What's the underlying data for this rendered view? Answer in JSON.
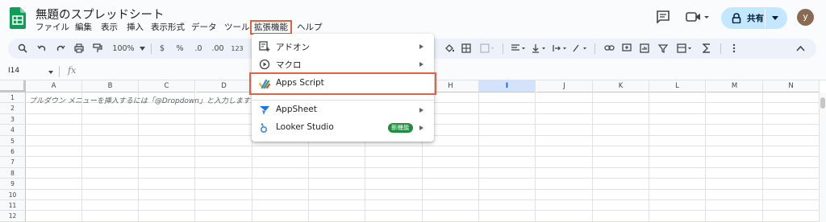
{
  "title": "無題のスプレッドシート",
  "menu": [
    {
      "label": "ファイル"
    },
    {
      "label": "編集"
    },
    {
      "label": "表示"
    },
    {
      "label": "挿入"
    },
    {
      "label": "表示形式"
    },
    {
      "label": "データ"
    },
    {
      "label": "ツール"
    },
    {
      "label": "拡張機能"
    },
    {
      "label": "ヘルプ"
    }
  ],
  "share": {
    "label": "共有"
  },
  "avatar": {
    "initial": "y"
  },
  "toolbar": {
    "zoom": "100%",
    "currency": "$",
    "percent": "%",
    "dec_less": ".0",
    "dec_more": ".00",
    "format_123": "123"
  },
  "formula_bar": {
    "cell_ref": "I14",
    "fx": "fx"
  },
  "grid": {
    "columns": [
      "A",
      "B",
      "C",
      "D",
      "E",
      "F",
      "G",
      "H",
      "I",
      "J",
      "K",
      "L",
      "M",
      "N"
    ],
    "selected_column": "I",
    "rows": [
      "1",
      "2",
      "3",
      "4",
      "5",
      "6",
      "7",
      "8",
      "9",
      "10",
      "11",
      "12"
    ],
    "a1_hint": "プルダウン メニューを挿入するには「@Dropdown」と入力します"
  },
  "dropdown": {
    "items": [
      {
        "label": "アドオン",
        "icon": "addons-icon",
        "has_submenu": true
      },
      {
        "label": "マクロ",
        "icon": "macro-play-icon",
        "has_submenu": true
      },
      {
        "label": "Apps Script",
        "icon": "apps-script-icon",
        "has_submenu": false
      },
      {
        "label": "AppSheet",
        "icon": "appsheet-icon",
        "has_submenu": true
      },
      {
        "label": "Looker Studio",
        "icon": "looker-studio-icon",
        "has_submenu": true,
        "badge": "新機能"
      }
    ]
  },
  "colors": {
    "highlight_border": "#e0623e",
    "share_bg": "#c2e7ff",
    "badge_bg": "#1e8e3e",
    "sheets_green": "#0f9d58"
  }
}
